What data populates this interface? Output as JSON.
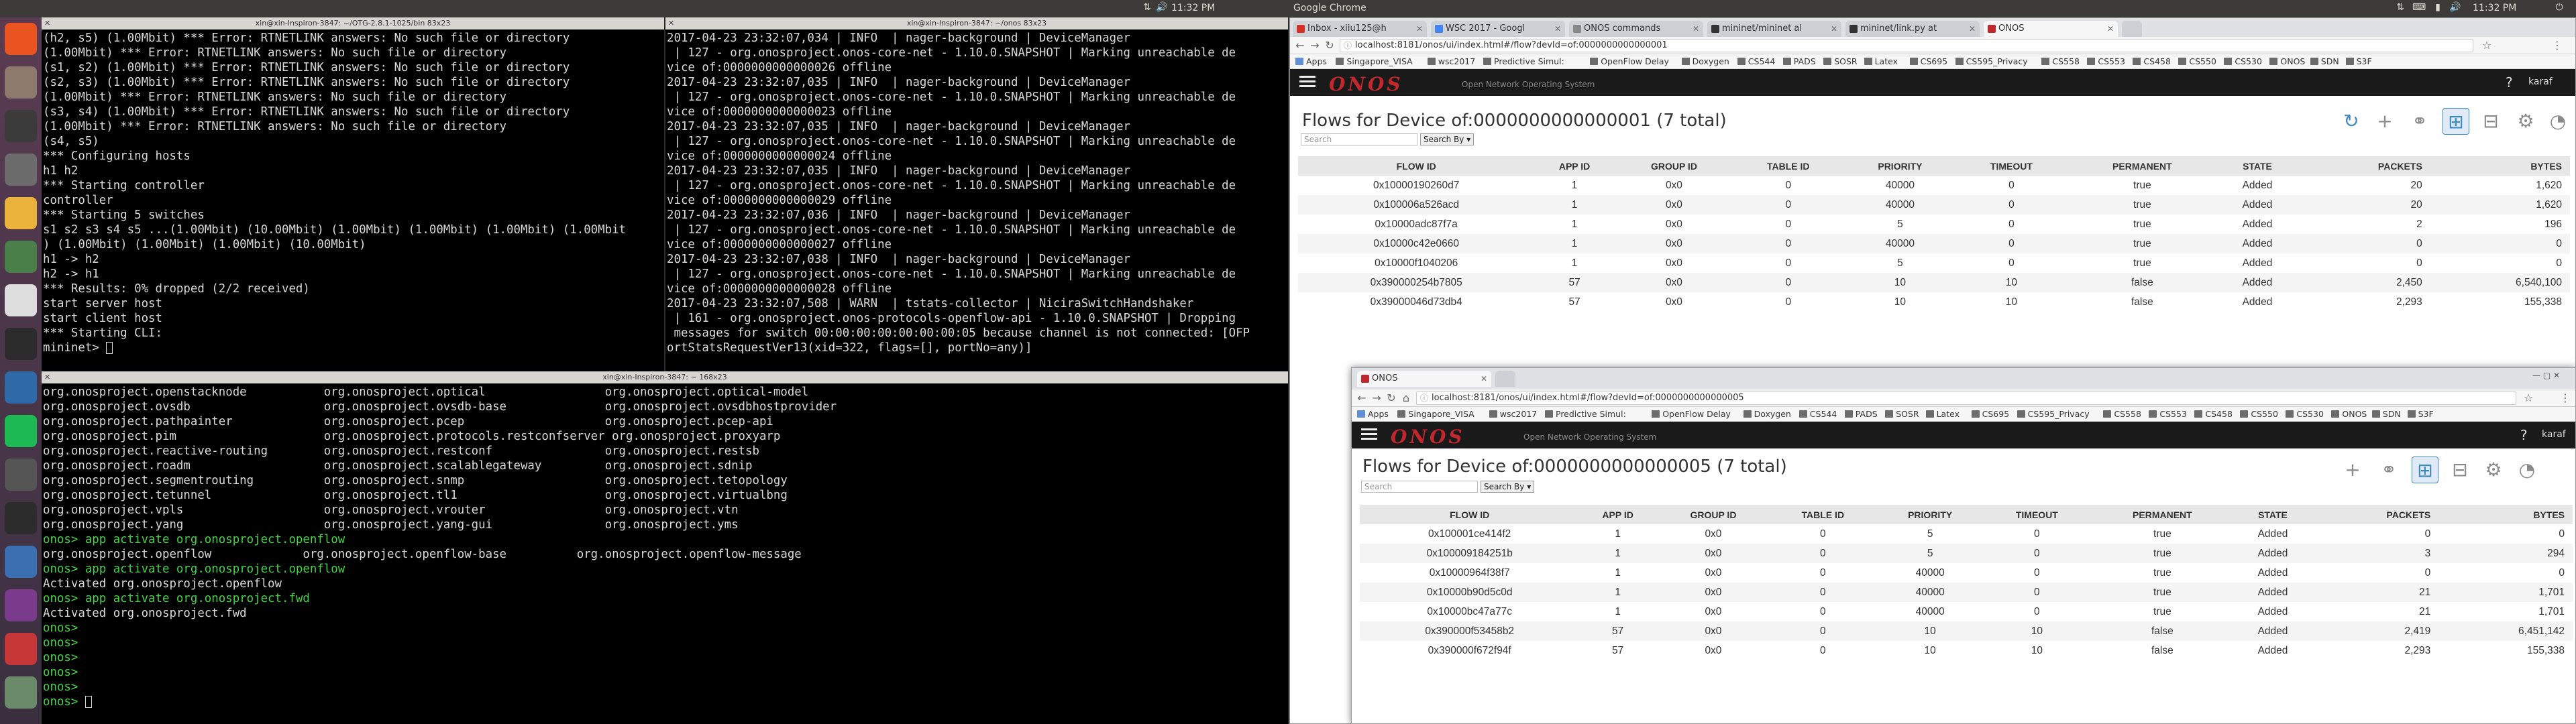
{
  "topbar": {
    "app_name": "Google Chrome",
    "time_left": "11:32 PM",
    "time_right": "11:32 PM"
  },
  "term1": {
    "title": "xin@xin-Inspiron-3847: ~/OTG-2.8.1-1025/bin 83x23",
    "lines": [
      "(h2, s5) (1.00Mbit) *** Error: RTNETLINK answers: No such file or directory",
      "(1.00Mbit) *** Error: RTNETLINK answers: No such file or directory",
      "(s1, s2) (1.00Mbit) *** Error: RTNETLINK answers: No such file or directory",
      "(s2, s3) (1.00Mbit) *** Error: RTNETLINK answers: No such file or directory",
      "(1.00Mbit) *** Error: RTNETLINK answers: No such file or directory",
      "(s3, s4) (1.00Mbit) *** Error: RTNETLINK answers: No such file or directory",
      "(1.00Mbit) *** Error: RTNETLINK answers: No such file or directory",
      "(s4, s5)",
      "*** Configuring hosts",
      "h1 h2",
      "*** Starting controller",
      "controller",
      "*** Starting 5 switches",
      "s1 s2 s3 s4 s5 ...(1.00Mbit) (10.00Mbit) (1.00Mbit) (1.00Mbit) (1.00Mbit) (1.00Mbit",
      ") (1.00Mbit) (1.00Mbit) (1.00Mbit) (10.00Mbit)",
      "h1 -> h2",
      "h2 -> h1",
      "*** Results: 0% dropped (2/2 received)",
      "start server host",
      "start client host",
      "*** Starting CLI:",
      "mininet> "
    ]
  },
  "term2": {
    "title": "xin@xin-Inspiron-3847: ~/onos 83x23",
    "lines": [
      "2017-04-23 23:32:07,034 | INFO  | nager-background | DeviceManager",
      " | 127 - org.onosproject.onos-core-net - 1.10.0.SNAPSHOT | Marking unreachable de",
      "vice of:0000000000000026 offline",
      "2017-04-23 23:32:07,035 | INFO  | nager-background | DeviceManager",
      " | 127 - org.onosproject.onos-core-net - 1.10.0.SNAPSHOT | Marking unreachable de",
      "vice of:0000000000000023 offline",
      "2017-04-23 23:32:07,035 | INFO  | nager-background | DeviceManager",
      " | 127 - org.onosproject.onos-core-net - 1.10.0.SNAPSHOT | Marking unreachable de",
      "vice of:0000000000000024 offline",
      "2017-04-23 23:32:07,035 | INFO  | nager-background | DeviceManager",
      " | 127 - org.onosproject.onos-core-net - 1.10.0.SNAPSHOT | Marking unreachable de",
      "vice of:0000000000000029 offline",
      "2017-04-23 23:32:07,036 | INFO  | nager-background | DeviceManager",
      " | 127 - org.onosproject.onos-core-net - 1.10.0.SNAPSHOT | Marking unreachable de",
      "vice of:0000000000000027 offline",
      "2017-04-23 23:32:07,038 | INFO  | nager-background | DeviceManager",
      " | 127 - org.onosproject.onos-core-net - 1.10.0.SNAPSHOT | Marking unreachable de",
      "vice of:0000000000000028 offline",
      "2017-04-23 23:32:07,508 | WARN  | tstats-collector | NiciraSwitchHandshaker",
      " | 161 - org.onosproject.onos-protocols-openflow-api - 1.10.0.SNAPSHOT | Dropping",
      " messages for switch 00:00:00:00:00:00:00:05 because channel is not connected: [OFP",
      "ortStatsRequestVer13(xid=322, flags=[], portNo=any)]"
    ]
  },
  "term3": {
    "title": "xin@xin-Inspiron-3847: ~ 168x23",
    "lines": [
      "org.onosproject.openstacknode           org.onosproject.optical                 org.onosproject.optical-model",
      "org.onosproject.ovsdb                   org.onosproject.ovsdb-base              org.onosproject.ovsdbhostprovider",
      "org.onosproject.pathpainter             org.onosproject.pcep                    org.onosproject.pcep-api",
      "org.onosproject.pim                     org.onosproject.protocols.restconfserver org.onosproject.proxyarp",
      "org.onosproject.reactive-routing        org.onosproject.restconf                org.onosproject.restsb",
      "org.onosproject.roadm                   org.onosproject.scalablegateway         org.onosproject.sdnip",
      "org.onosproject.segmentrouting          org.onosproject.snmp                    org.onosproject.tetopology",
      "org.onosproject.tetunnel                org.onosproject.tl1                     org.onosproject.virtualbng",
      "org.onosproject.vpls                    org.onosproject.vrouter                 org.onosproject.vtn",
      "org.onosproject.yang                    org.onosproject.yang-gui                org.onosproject.yms",
      "onos> app activate org.onosproject.openflow",
      "org.onosproject.openflow             org.onosproject.openflow-base          org.onosproject.openflow-message",
      "onos> app activate org.onosproject.openflow",
      "Activated org.onosproject.openflow",
      "onos> app activate org.onosproject.fwd",
      "Activated org.onosproject.fwd",
      "onos>",
      "onos>",
      "onos>",
      "onos>",
      "onos>",
      "onos> "
    ]
  },
  "chrome1": {
    "tabs": [
      {
        "label": "Inbox - xiiu125@h",
        "color": "#d93025"
      },
      {
        "label": "WSC 2017 - Googl",
        "color": "#4285f4"
      },
      {
        "label": "ONOS commands",
        "color": "#888888"
      },
      {
        "label": "mininet/mininet al",
        "color": "#333333"
      },
      {
        "label": "mininet/link.py at",
        "color": "#333333"
      },
      {
        "label": "ONOS",
        "color": "#c1272d"
      }
    ],
    "url": "localhost:8181/onos/ui/index.html#/flow?devId=of:0000000000000001",
    "title": "Flows for Device of:0000000000000001 (7 total)",
    "search_placeholder": "Search",
    "search_by": "Search By",
    "user": "karaf",
    "rows": [
      [
        "0x10000190260d7",
        "1",
        "0x0",
        "0",
        "40000",
        "0",
        "true",
        "Added",
        "20",
        "1,620"
      ],
      [
        "0x100006a526acd",
        "1",
        "0x0",
        "0",
        "40000",
        "0",
        "true",
        "Added",
        "20",
        "1,620"
      ],
      [
        "0x10000adc87f7a",
        "1",
        "0x0",
        "0",
        "5",
        "0",
        "true",
        "Added",
        "2",
        "196"
      ],
      [
        "0x10000c42e0660",
        "1",
        "0x0",
        "0",
        "40000",
        "0",
        "true",
        "Added",
        "0",
        "0"
      ],
      [
        "0x10000f1040206",
        "1",
        "0x0",
        "0",
        "5",
        "0",
        "true",
        "Added",
        "0",
        "0"
      ],
      [
        "0x390000254b7805",
        "57",
        "0x0",
        "0",
        "10",
        "10",
        "false",
        "Added",
        "2,450",
        "6,540,100"
      ],
      [
        "0x39000046d73db4",
        "57",
        "0x0",
        "0",
        "10",
        "10",
        "false",
        "Added",
        "2,293",
        "155,338"
      ]
    ]
  },
  "chrome2": {
    "tabs": [
      {
        "label": "ONOS",
        "color": "#c1272d"
      }
    ],
    "url": "localhost:8181/onos/ui/index.html#/flow?devId=of:0000000000000005",
    "title": "Flows for Device of:0000000000000005 (7 total)",
    "search_placeholder": "Search",
    "search_by": "Search By",
    "user": "karaf",
    "rows": [
      [
        "0x100001ce414f2",
        "1",
        "0x0",
        "0",
        "5",
        "0",
        "true",
        "Added",
        "0",
        "0"
      ],
      [
        "0x100009184251b",
        "1",
        "0x0",
        "0",
        "5",
        "0",
        "true",
        "Added",
        "3",
        "294"
      ],
      [
        "0x10000964f38f7",
        "1",
        "0x0",
        "0",
        "40000",
        "0",
        "true",
        "Added",
        "0",
        "0"
      ],
      [
        "0x10000b90d5c0d",
        "1",
        "0x0",
        "0",
        "40000",
        "0",
        "true",
        "Added",
        "21",
        "1,701"
      ],
      [
        "0x10000bc47a77c",
        "1",
        "0x0",
        "0",
        "40000",
        "0",
        "true",
        "Added",
        "21",
        "1,701"
      ],
      [
        "0x390000f53458b2",
        "57",
        "0x0",
        "0",
        "10",
        "10",
        "false",
        "Added",
        "2,419",
        "6,451,142"
      ],
      [
        "0x390000f672f94f",
        "57",
        "0x0",
        "0",
        "10",
        "10",
        "false",
        "Added",
        "2,293",
        "155,338"
      ]
    ]
  },
  "bookmarks": {
    "items": [
      "Apps",
      "Singapore_VISA",
      "wsc2017",
      "Predictive Simul:",
      "OpenFlow Delay",
      "Doxygen",
      "CS544",
      "PADS",
      "SOSR",
      "Latex",
      "CS695",
      "CS595_Privacy",
      "CS558",
      "CS553",
      "CS458",
      "CS550",
      "CS530",
      "ONOS",
      "SDN",
      "S3F"
    ]
  },
  "columns": [
    "FLOW ID",
    "APP ID",
    "GROUP ID",
    "TABLE ID",
    "PRIORITY",
    "TIMEOUT",
    "PERMANENT",
    "STATE",
    "PACKETS",
    "BYTES"
  ],
  "onos": {
    "logo": "ONOS",
    "subtitle": "Open Network Operating System"
  },
  "launcher": {
    "icons": [
      "home-icon",
      "files-icon",
      "dash-icon",
      "settings-icon",
      "chrome-icon",
      "editor-icon",
      "tex-icon",
      "terminal-icon",
      "monitor-icon",
      "spotify-icon",
      "camera-icon",
      "terminal2-icon",
      "vbox-icon",
      "shotwell-icon",
      "image-icon",
      "trash-icon"
    ]
  }
}
